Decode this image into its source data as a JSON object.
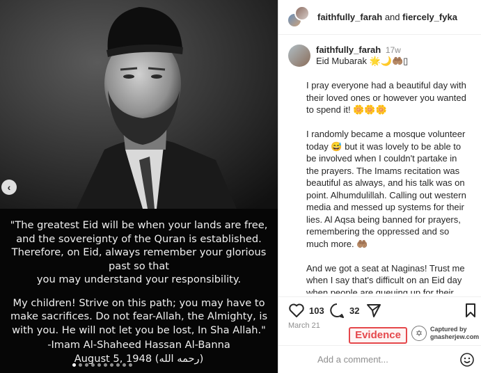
{
  "media": {
    "quote_lines": [
      "\"The greatest Eid will be when your lands are free,",
      "and the sovereignty of the Quran is established.",
      "Therefore, on Eid, always remember your glorious",
      "past so that",
      "you may understand your responsibility."
    ],
    "quote_lines_2": [
      "My children! Strive on this path; you may have to",
      "make sacrifices. Do not fear-Allah, the Almighty, is",
      "with you. He will not let you be lost, In Sha Allah.\""
    ],
    "attribution_name": "-Imam Al-Shaheed Hassan Al-Banna",
    "attribution_date": "August 5, 1948 (رحمه الله)",
    "prev_icon": "chevron-left-icon",
    "carousel_dots": 10,
    "carousel_active": 0
  },
  "header": {
    "user1": "faithfully_farah",
    "conjunction": "and",
    "user2": "fiercely_fyka"
  },
  "caption": {
    "username": "faithfully_farah",
    "time": "17w",
    "eid_line": "Eid Mubarak 🌟🌙🤲🏽▯",
    "text": "I pray everyone had a beautiful day with their loved ones or however you wanted to spend it! 🌼🌼🌼\n\nI randomly became a mosque volunteer today 😅 but it was lovely to be able to be involved when I couldn't partake in the prayers. The Imams recitation was beautiful as always, and his talk was on point. Alhumdulillah. Calling out western media and messed up systems for their lies. Al Aqsa being banned for prayers, remembering the oppressed and so much more. 🤲🏽\n\nAnd we got a seat at Naginas! Trust me when I say that's difficult on an Eid day when people are queuing up for their traditional halwa puri! You can see the"
  },
  "actions": {
    "likes": "103",
    "comments": "32",
    "icons": [
      "heart-icon",
      "comment-icon",
      "share-icon",
      "bookmark-icon"
    ]
  },
  "date": "March 21",
  "evidence_label": "Evidence",
  "captured": {
    "line1": "Captured by",
    "line2": "gnasherjew.com"
  },
  "comment": {
    "placeholder": "Add a comment..."
  },
  "colors": {
    "evidence_red": "#e5474b",
    "meta_grey": "#8e8e8e",
    "text": "#262626"
  }
}
